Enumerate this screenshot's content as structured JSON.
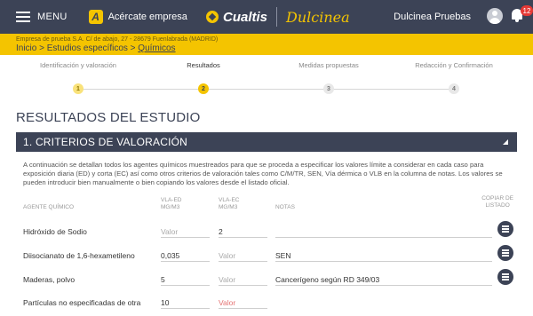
{
  "topbar": {
    "menu_label": "MENU",
    "acercate_label": "Acércate empresa",
    "brand_name": "Cualtis",
    "brand_sub": "Dulcinea",
    "user_name": "Dulcinea Pruebas",
    "notification_count": "12"
  },
  "company": {
    "address": "Empresa de prueba S.A. C/ de abajo, 27 - 28679 Fuenlabrada (MADRID)",
    "crumb_prefix": "Inicio > Estudios específicos > ",
    "crumb_link": "Químicos"
  },
  "stepper": {
    "steps": [
      {
        "label": "Identificación y valoración",
        "number": "1",
        "state": "done"
      },
      {
        "label": "Resultados",
        "number": "2",
        "state": "active"
      },
      {
        "label": "Medidas propuestas",
        "number": "3",
        "state": "pending"
      },
      {
        "label": "Redacción y Confirmación",
        "number": "4",
        "state": "pending"
      }
    ]
  },
  "main": {
    "section_title": "RESULTADOS DEL ESTUDIO",
    "accordion_title": "1. CRITERIOS DE VALORACIÓN",
    "intro": "A continuación se detallan todos los agentes químicos muestreados para que se proceda a especificar los valores límite a considerar en cada caso para exposición diaria (ED) y corta (EC) así como otros criterios de valoración tales como C/M/TR, SEN, Vía dérmica o VLB en la columna de notas. Los valores se pueden introducir bien manualmente o bien copiando los valores desde el listado oficial."
  },
  "table": {
    "headers": {
      "agent": "AGENTE QUÍMICO",
      "ved_line1": "VLA-ED",
      "ved_line2": "mg/m3",
      "vec_line1": "VLA-EC",
      "vec_line2": "mg/m3",
      "notes": "NOTAS",
      "copy_line1": "COPIAR DE",
      "copy_line2": "LISTADO"
    },
    "rows": [
      {
        "name": "Hidróxido de Sodio",
        "ved": "",
        "ved_placeholder": "Valor",
        "vec": "2",
        "vec_placeholder": "Valor",
        "notes": ""
      },
      {
        "name": "Diisocianato de 1,6-hexametileno",
        "ved": "0,035",
        "ved_placeholder": "Valor",
        "vec": "",
        "vec_placeholder": "Valor",
        "notes": "SEN"
      },
      {
        "name": "Maderas, polvo",
        "ved": "5",
        "ved_placeholder": "Valor",
        "vec": "",
        "vec_placeholder": "Valor",
        "notes": "Cancerígeno según RD 349/03"
      },
      {
        "name": "Partículas no especificadas de otra",
        "ved": "10",
        "ved_placeholder": "Valor",
        "vec": "",
        "vec_placeholder": "Valor",
        "notes": ""
      }
    ]
  }
}
